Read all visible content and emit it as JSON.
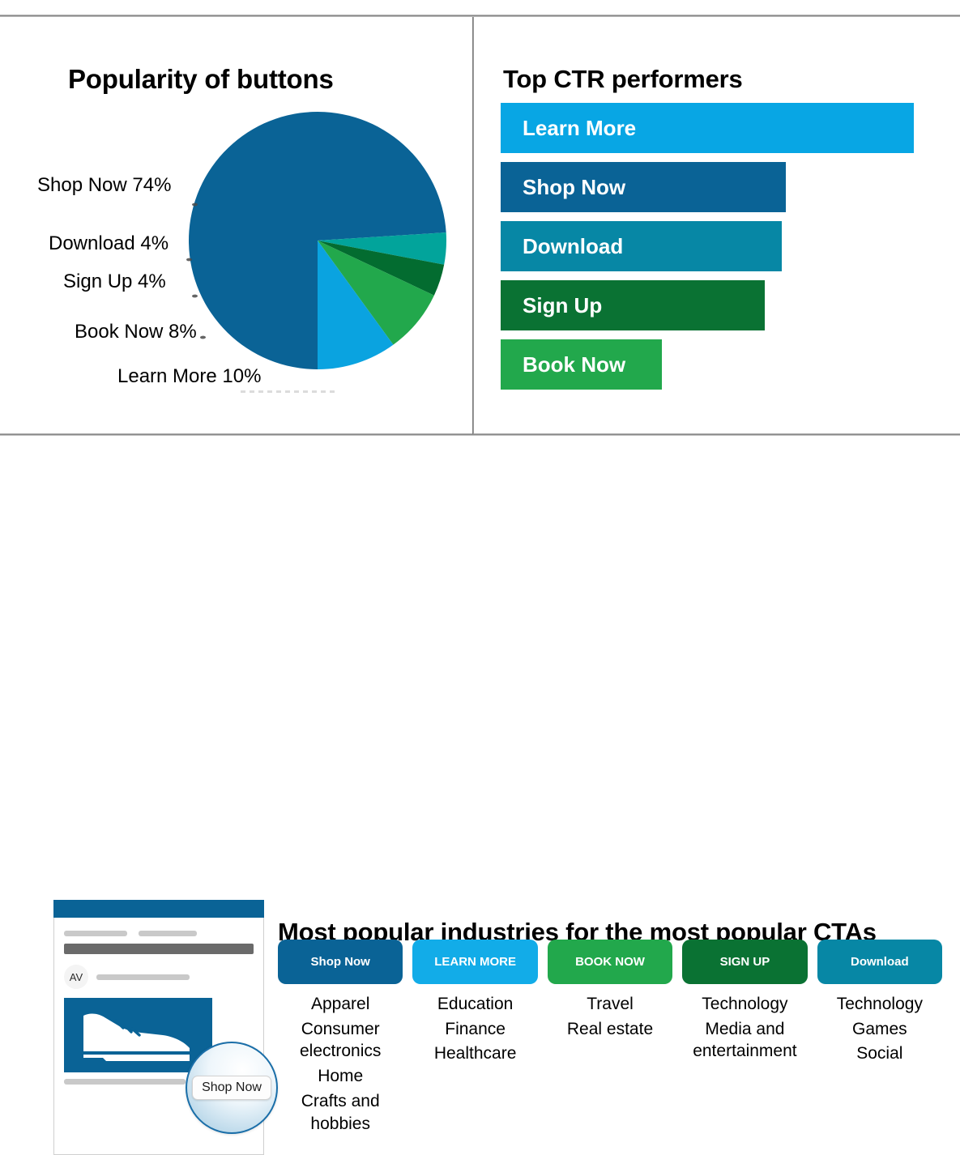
{
  "panels": {
    "popularity": {
      "title": "Popularity of buttons"
    },
    "ctr": {
      "title": "Top CTR performers"
    },
    "industries": {
      "title": "Most popular industries for the most popular CTAs"
    }
  },
  "chart_data": [
    {
      "type": "pie",
      "title": "Popularity of buttons",
      "categories": [
        "Shop Now",
        "Learn More",
        "Book Now",
        "Sign Up",
        "Download"
      ],
      "values": [
        74,
        10,
        8,
        4,
        4
      ],
      "unit": "%",
      "labels": [
        "Shop Now 74%",
        "Download 4%",
        "Sign Up 4%",
        "Book Now 8%",
        "Learn More 10%"
      ],
      "colors": [
        "#0A6396",
        "#0AA3E0",
        "#22A84C",
        "#036C30",
        "#02A49B"
      ],
      "legend": "labels-outside",
      "start_angle_deg": 180,
      "direction": "clockwise"
    },
    {
      "type": "bar",
      "orientation": "horizontal",
      "title": "Top CTR performers",
      "categories": [
        "Learn More",
        "Shop Now",
        "Download",
        "Sign Up",
        "Book Now"
      ],
      "values": [
        100,
        69,
        68,
        64,
        39
      ],
      "xlabel": "",
      "ylabel": "",
      "grid": false,
      "colors": [
        "#08A6E4",
        "#0A6396",
        "#0787A5",
        "#0A7233",
        "#22A84C"
      ]
    }
  ],
  "pie": {
    "slices": [
      {
        "name": "Shop Now",
        "label": "Shop Now 74%",
        "value": 74,
        "color": "#0A6396"
      },
      {
        "name": "Download",
        "label": "Download 4%",
        "value": 4,
        "color": "#02A49B"
      },
      {
        "name": "Sign Up",
        "label": "Sign Up 4%",
        "value": 4,
        "color": "#036C30"
      },
      {
        "name": "Book Now",
        "label": "Book Now 8%",
        "value": 8,
        "color": "#22A84C"
      },
      {
        "name": "Learn More",
        "label": "Learn More 10%",
        "value": 10,
        "color": "#0AA3E0"
      }
    ]
  },
  "ctr_bars": [
    {
      "label": "Learn More",
      "width_pct": 100,
      "color": "#08A6E4"
    },
    {
      "label": "Shop Now",
      "width_pct": 69,
      "color": "#0A6396"
    },
    {
      "label": "Download",
      "width_pct": 68,
      "color": "#0787A5"
    },
    {
      "label": "Sign Up",
      "width_pct": 64,
      "color": "#0A7233"
    },
    {
      "label": "Book Now",
      "width_pct": 39,
      "color": "#22A84C"
    }
  ],
  "industry_columns": [
    {
      "cta": "Shop Now",
      "cta_color": "#0A6396",
      "chip_height": 55,
      "industries": [
        "Apparel",
        "Consumer electronics",
        "Home",
        "Crafts and hobbies"
      ]
    },
    {
      "cta": "LEARN MORE",
      "cta_color": "#12ACE8",
      "chip_height": 55,
      "industries": [
        "Education",
        "Finance",
        "Healthcare"
      ]
    },
    {
      "cta": "BOOK NOW",
      "cta_color": "#22A84C",
      "chip_height": 55,
      "industries": [
        "Travel",
        "Real estate"
      ]
    },
    {
      "cta": "SIGN UP",
      "cta_color": "#0A7233",
      "chip_height": 55,
      "industries": [
        "Technology",
        "Media and entertainment"
      ]
    },
    {
      "cta": "Download",
      "cta_color": "#0787A5",
      "chip_height": 55,
      "industries": [
        "Technology",
        "Games",
        "Social"
      ]
    }
  ],
  "phone_mockup": {
    "avatar_initials": "AV",
    "magnifier_button_label": "Shop Now",
    "accent_color": "#0A6396"
  }
}
